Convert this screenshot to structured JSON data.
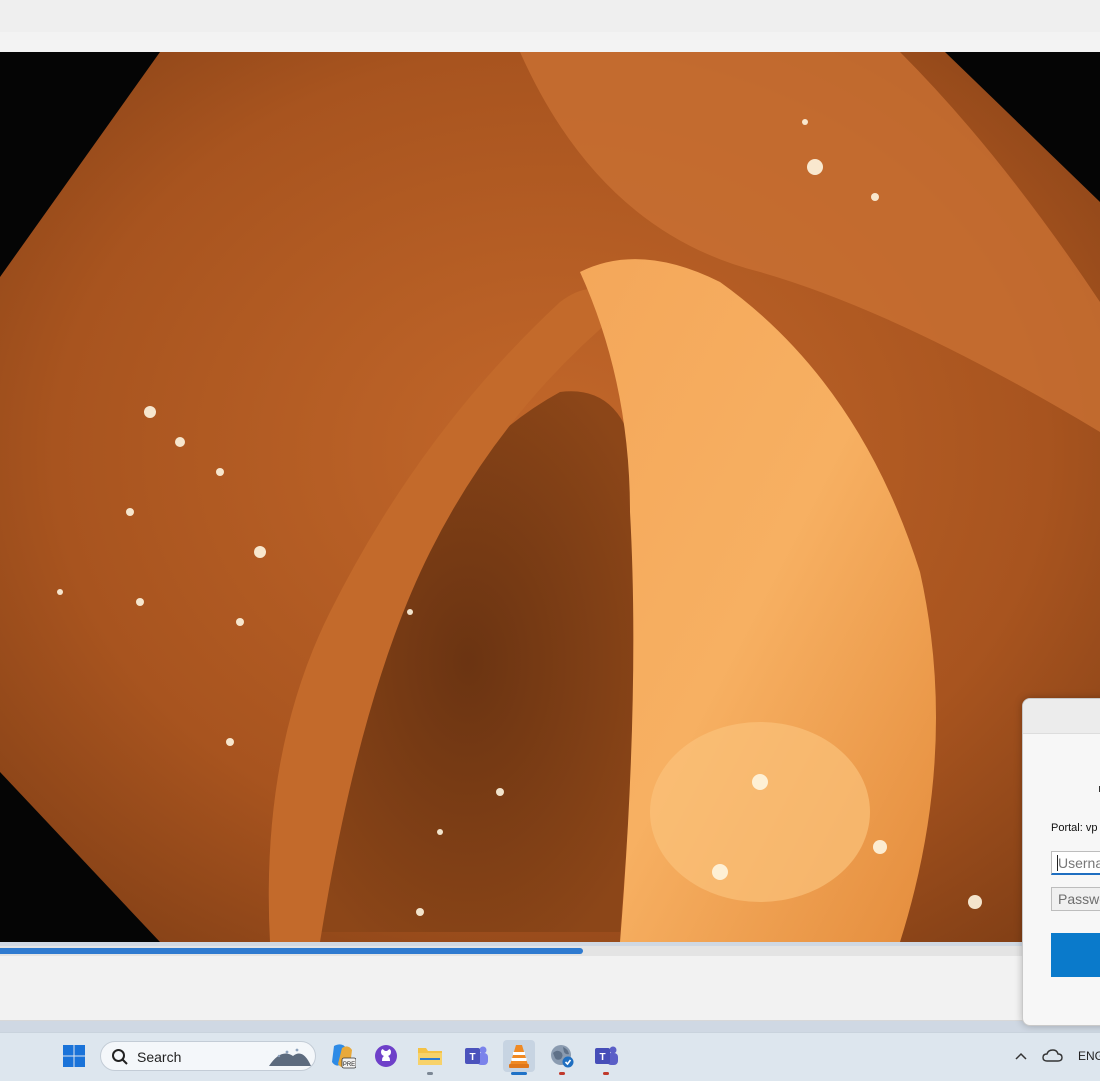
{
  "player": {
    "progress_fraction": 0.53
  },
  "dialog": {
    "portal_label": "Portal: vp",
    "username_placeholder": "Userna",
    "password_placeholder": "Passwo"
  },
  "taskbar": {
    "search_label": "Search",
    "items": [
      "windows-start",
      "search",
      "copilot",
      "github-desktop",
      "file-explorer",
      "teams-classic",
      "vlc",
      "vpn-globe",
      "teams"
    ],
    "tray_language": "ENG"
  },
  "colors": {
    "accent": "#0a7acb",
    "seek_fill": "#2f7bd0"
  }
}
